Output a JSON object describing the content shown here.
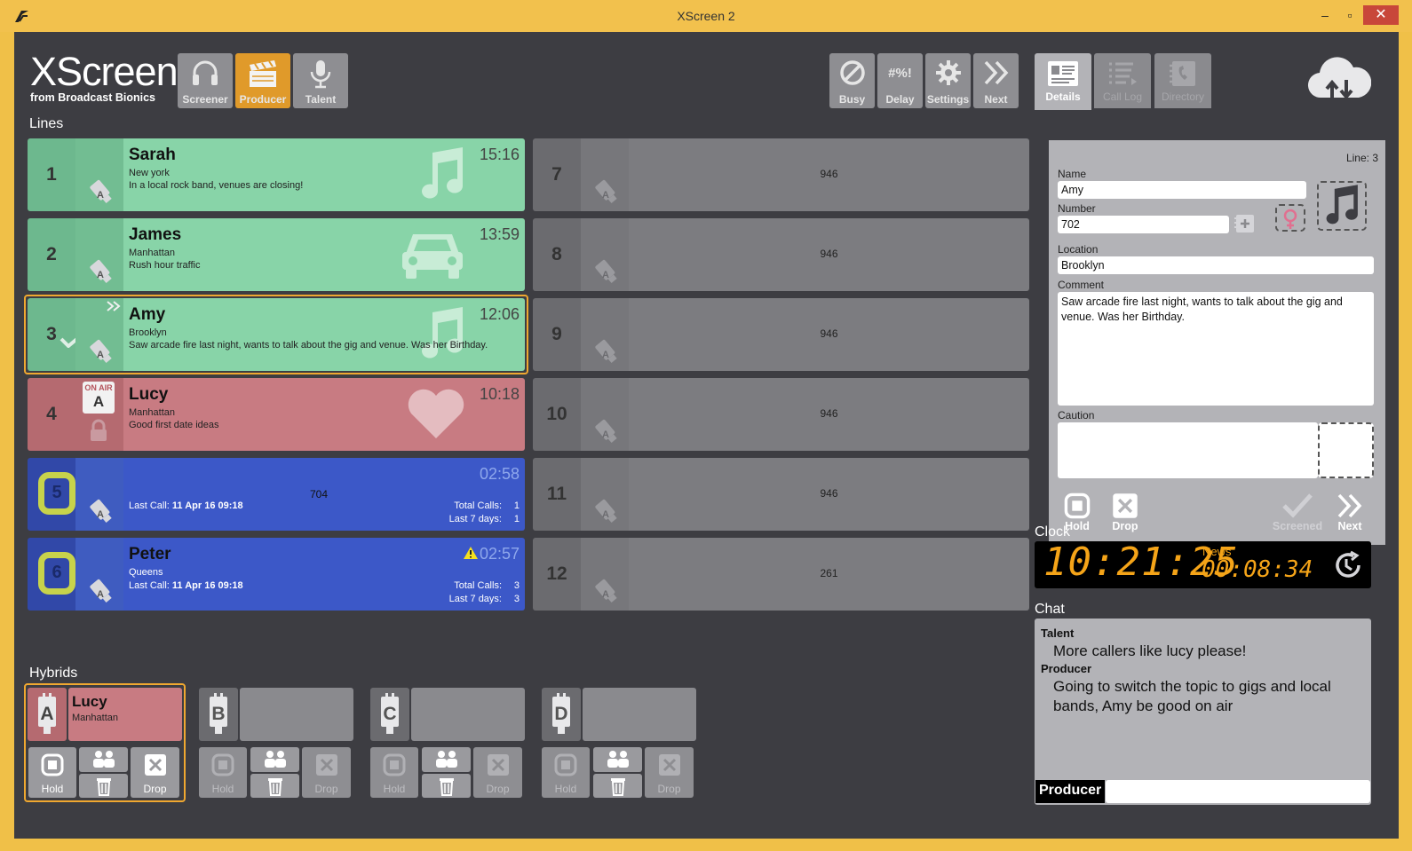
{
  "window": {
    "title": "XScreen 2",
    "minimize": "–",
    "maximize": "▫",
    "close": "✕"
  },
  "brand": {
    "name": "XScreen",
    "tagline": "from Broadcast Bionics"
  },
  "modes": [
    {
      "label": "Screener",
      "icon": "headset-icon"
    },
    {
      "label": "Producer",
      "icon": "clapperboard-icon",
      "active": true
    },
    {
      "label": "Talent",
      "icon": "microphone-icon"
    }
  ],
  "toolbar": {
    "busy": "Busy",
    "delay": "Delay",
    "delay_glyph": "#%!",
    "settings": "Settings",
    "next": "Next"
  },
  "sections": {
    "lines": "Lines",
    "hybrids": "Hybrids",
    "clock": "Clock",
    "chat": "Chat"
  },
  "lines_left": [
    {
      "num": "1",
      "name": "Sarah",
      "location": "New york",
      "comment": "In a local rock band, venues are closing!",
      "time": "15:16",
      "state": "green",
      "icon": "music-note-icon"
    },
    {
      "num": "2",
      "name": "James",
      "location": "Manhattan",
      "comment": "Rush hour traffic",
      "time": "13:59",
      "state": "green",
      "icon": "car-icon"
    },
    {
      "num": "3",
      "name": "Amy",
      "location": "Brooklyn",
      "comment": "Saw arcade fire last night, wants to talk about the gig and venue. Was her Birthday.",
      "time": "12:06",
      "state": "green",
      "icon": "music-note-icon",
      "selected": true
    },
    {
      "num": "4",
      "name": "Lucy",
      "location": "Manhattan",
      "comment": "Good first date ideas",
      "time": "10:18",
      "state": "red",
      "icon": "heart-icon",
      "onair_label": "ON AIR",
      "onair_hybrid": "A"
    },
    {
      "num": "5",
      "name": "",
      "location": "",
      "time": "02:58",
      "state": "blue",
      "number": "704",
      "last_call_label": "Last Call:",
      "last_call": "11 Apr 16 09:18",
      "total_calls_label": "Total Calls:",
      "total_calls": "1",
      "last7_label": "Last 7 days:",
      "last7": "1"
    },
    {
      "num": "6",
      "name": "Peter",
      "location": "Queens",
      "time": "02:57",
      "state": "blue",
      "warning": true,
      "last_call_label": "Last Call:",
      "last_call": "11 Apr 16 09:18",
      "total_calls_label": "Total Calls:",
      "total_calls": "3",
      "last7_label": "Last 7 days:",
      "last7": "3"
    }
  ],
  "lines_right": [
    {
      "num": "7",
      "value": "946"
    },
    {
      "num": "8",
      "value": "946"
    },
    {
      "num": "9",
      "value": "946"
    },
    {
      "num": "10",
      "value": "946"
    },
    {
      "num": "11",
      "value": "946"
    },
    {
      "num": "12",
      "value": "261"
    }
  ],
  "hybrids": [
    {
      "letter": "A",
      "name": "Lucy",
      "location": "Manhattan",
      "active": true
    },
    {
      "letter": "B",
      "name": "",
      "location": ""
    },
    {
      "letter": "C",
      "name": "",
      "location": ""
    },
    {
      "letter": "D",
      "name": "",
      "location": ""
    }
  ],
  "hybrid_controls": {
    "hold": "Hold",
    "drop": "Drop"
  },
  "tabs": [
    {
      "label": "Details",
      "active": true
    },
    {
      "label": "Call Log"
    },
    {
      "label": "Directory"
    }
  ],
  "details": {
    "line_label": "Line: 3",
    "name_label": "Name",
    "name": "Amy",
    "number_label": "Number",
    "number": "702",
    "location_label": "Location",
    "location": "Brooklyn",
    "comment_label": "Comment",
    "comment": "Saw arcade fire last night, wants to talk about the gig and venue. Was her Birthday.",
    "caution_label": "Caution",
    "caution": "",
    "hold": "Hold",
    "drop": "Drop",
    "screened": "Screened",
    "next": "Next"
  },
  "clock": {
    "time": "10:21:25",
    "news_label": "News",
    "news_countdown": "00:08:34"
  },
  "chat": {
    "messages": [
      {
        "sender": "Talent",
        "text": "More callers like lucy please!"
      },
      {
        "sender": "Producer",
        "text": "Going to switch the topic to gigs and local bands, Amy be good on air"
      }
    ],
    "input_sender": "Producer",
    "input_value": ""
  },
  "colors": {
    "accent": "#e09a2a",
    "green_line": "#88d4a8",
    "red_line": "#c87b82",
    "blue_line": "#3c58c8",
    "grey_line": "#7c7c80",
    "clock_digits": "#f5a418",
    "background": "#3d3d42"
  }
}
